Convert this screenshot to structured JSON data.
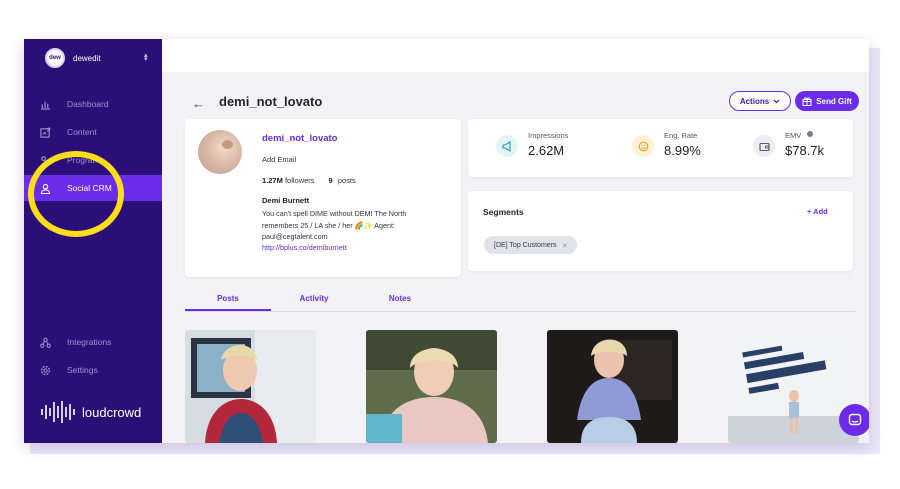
{
  "workspace": {
    "avatar_text": "dew",
    "name": "dewedit"
  },
  "sidebar": {
    "items": [
      {
        "label": "Dashboard",
        "icon": "bar-chart-icon"
      },
      {
        "label": "Content",
        "icon": "image-edit-icon"
      },
      {
        "label": "Programs",
        "icon": "programs-icon"
      },
      {
        "label": "Social CRM",
        "icon": "user-icon",
        "active": true
      },
      {
        "label": "Integrations",
        "icon": "integrations-icon"
      },
      {
        "label": "Settings",
        "icon": "gear-icon"
      }
    ],
    "brand": "loudcrowd"
  },
  "header": {
    "title": "demi_not_lovato",
    "actions_label": "Actions",
    "send_gift_label": "Send Gift"
  },
  "profile": {
    "handle": "demi_not_lovato",
    "add_email": "Add Email",
    "followers": "1.27M",
    "followers_label": "followers",
    "posts": "9",
    "posts_label": "posts",
    "name": "Demi Burnett",
    "bio": "You can't spell DIME without DEMI The North remembers 25 / LA she / her 🌈✨ Agent: paul@cegtalent.com",
    "link": "http://bplus.co/demiburnett"
  },
  "metrics": [
    {
      "label": "Impressions",
      "value": "2.62M",
      "icon": "megaphone-icon",
      "color": "#e4f4f8",
      "fg": "#2a9ab5"
    },
    {
      "label": "Eng. Rate",
      "value": "8.99%",
      "icon": "smile-icon",
      "color": "#fdf1d8",
      "fg": "#e2a31a"
    },
    {
      "label": "EMV",
      "value": "$78.7k",
      "icon": "wallet-icon",
      "color": "#ececf2",
      "fg": "#555566"
    }
  ],
  "segments": {
    "title": "Segments",
    "add_label": "+ Add",
    "tags": [
      "[DE] Top Customers"
    ]
  },
  "tabs": [
    "Posts",
    "Activity",
    "Notes"
  ],
  "posts": [
    {
      "image": "post-photo-1"
    },
    {
      "image": "post-photo-2"
    },
    {
      "image": "post-photo-3"
    },
    {
      "image": "post-photo-4"
    }
  ],
  "colors": {
    "sidebar": "#2b0f79",
    "accent": "#6a2ce8",
    "highlight": "#ffdd19"
  }
}
